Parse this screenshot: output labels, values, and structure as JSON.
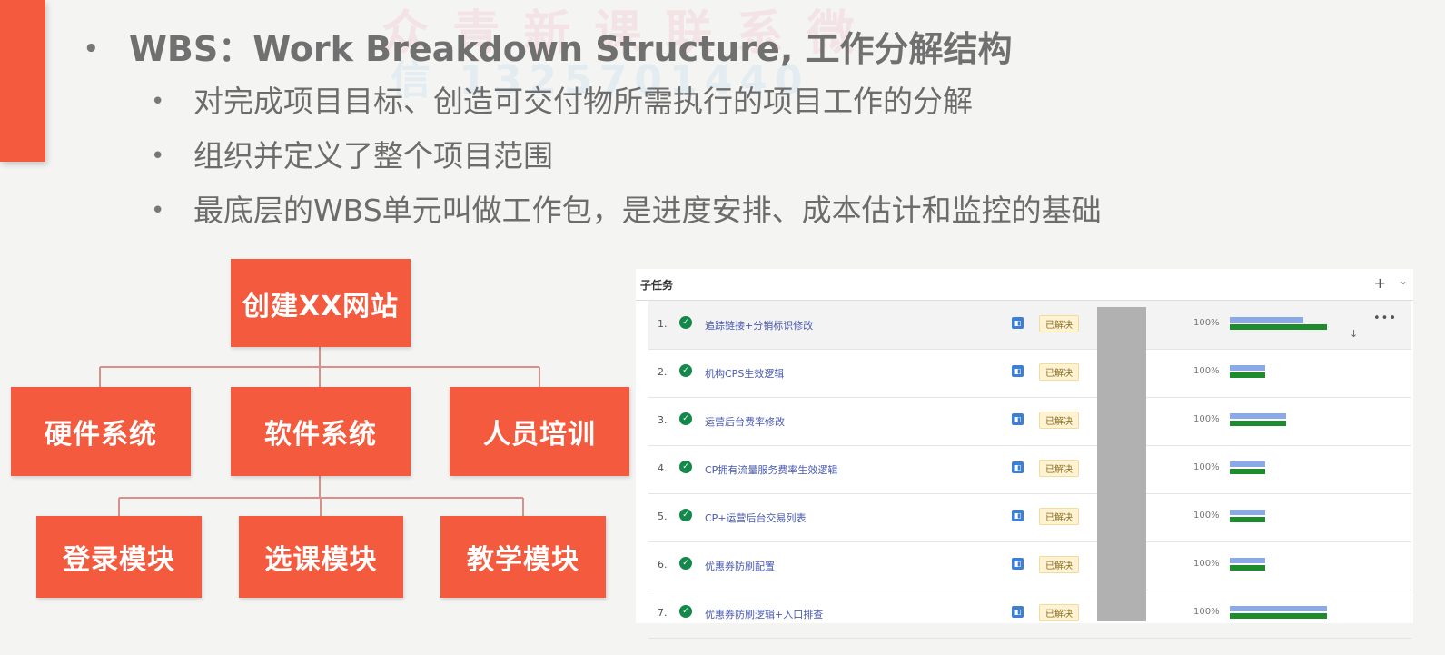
{
  "slide": {
    "title": "WBS：Work Breakdown Structure, 工作分解结构",
    "sub_bullets": [
      "对完成项目目标、创造可交付物所需执行的项目工作的分解",
      "组织并定义了整个项目范围",
      "最底层的WBS单元叫做工作包，是进度安排、成本估计和监控的基础"
    ],
    "watermark_line1": "众 青 新 课 联 系 微",
    "watermark_line2": "信 1325701440"
  },
  "wbs": {
    "root": "创建XX网站",
    "level1": [
      "硬件系统",
      "软件系统",
      "人员培训"
    ],
    "level2": [
      "登录模块",
      "选课模块",
      "教学模块"
    ],
    "node_color": "#f45a3d",
    "line_color": "#d9908a"
  },
  "subtasks": {
    "header": "子任务",
    "header_plus": "+",
    "header_chevron": "⌄",
    "more": "•••",
    "download": "↓",
    "rows": [
      {
        "num": "1.",
        "title": "追踪链接+分销标识修改",
        "status": "已解决",
        "percent": "100%",
        "plan": 0.31,
        "actual": 0.41
      },
      {
        "num": "2.",
        "title": "机构CPS生效逻辑",
        "status": "已解决",
        "percent": "100%",
        "plan": 0.15,
        "actual": 0.15
      },
      {
        "num": "3.",
        "title": "运营后台费率修改",
        "status": "已解决",
        "percent": "100%",
        "plan": 0.24,
        "actual": 0.24
      },
      {
        "num": "4.",
        "title": "CP拥有流量服务费率生效逻辑",
        "status": "已解决",
        "percent": "100%",
        "plan": 0.15,
        "actual": 0.15
      },
      {
        "num": "5.",
        "title": "CP+运营后台交易列表",
        "status": "已解决",
        "percent": "100%",
        "plan": 0.15,
        "actual": 0.15
      },
      {
        "num": "6.",
        "title": "优惠券防刷配置",
        "status": "已解决",
        "percent": "100%",
        "plan": 0.15,
        "actual": 0.15
      },
      {
        "num": "7.",
        "title": "优惠券防刷逻辑+入口排查",
        "status": "已解决",
        "percent": "100%",
        "plan": 0.41,
        "actual": 0.41
      }
    ]
  }
}
